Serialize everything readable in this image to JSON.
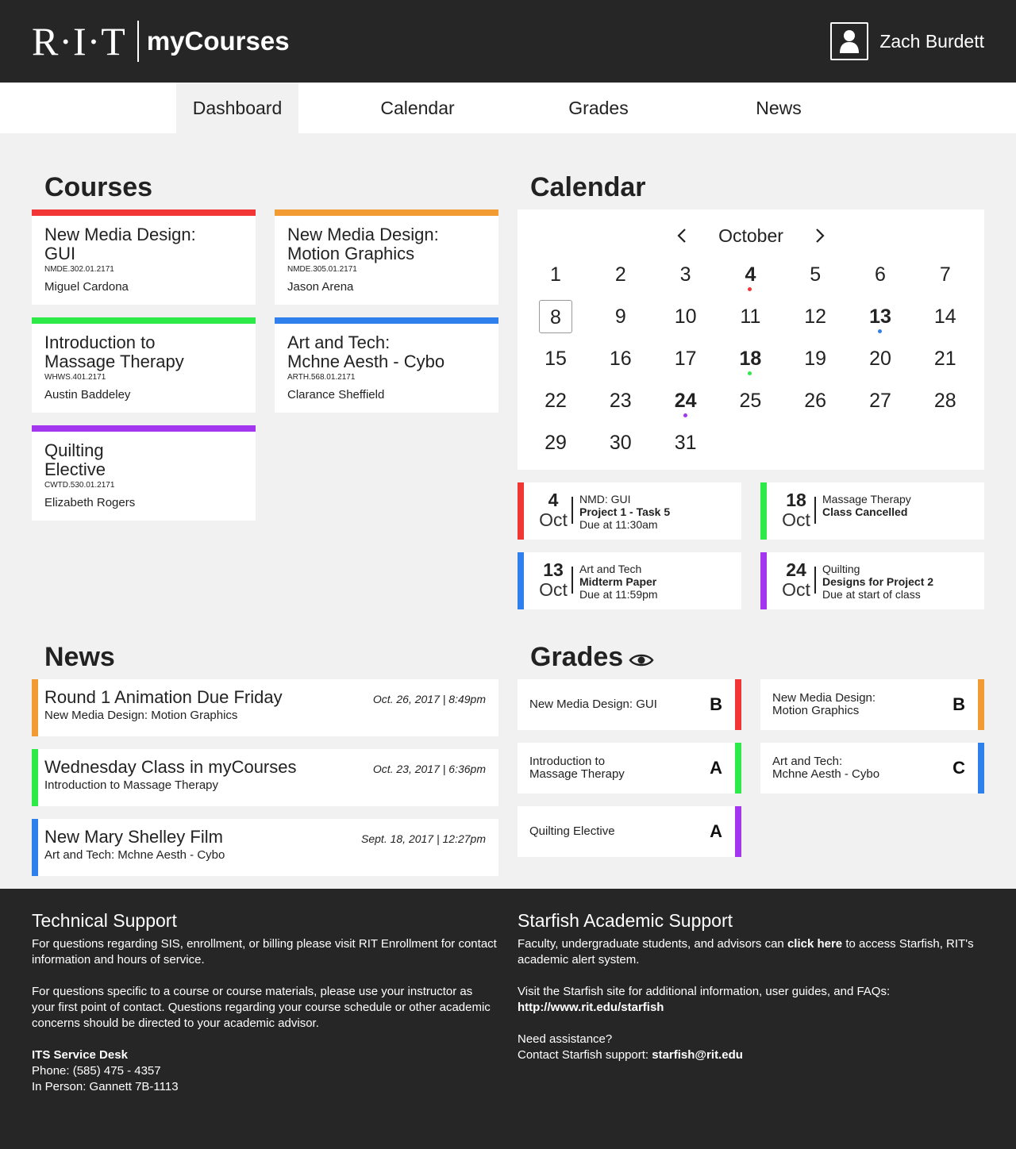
{
  "header": {
    "logo_text": "R·I·T",
    "app_name": "myCourses",
    "user_name": "Zach Burdett"
  },
  "nav": {
    "tabs": [
      {
        "label": "Dashboard",
        "active": true
      },
      {
        "label": "Calendar"
      },
      {
        "label": "Grades"
      },
      {
        "label": "News"
      }
    ]
  },
  "colors": {
    "red": "#f23535",
    "orange": "#f39b33",
    "green": "#2eea48",
    "blue": "#2f80ed",
    "purple": "#a336ef"
  },
  "courses": {
    "title": "Courses",
    "items": [
      {
        "name": "New Media Design:\nGUI",
        "code": "NMDE.302.01.2171",
        "instructor": "Miguel Cardona",
        "color": "#f23535"
      },
      {
        "name": "New Media Design:\nMotion Graphics",
        "code": "NMDE.305.01.2171",
        "instructor": "Jason Arena",
        "color": "#f39b33"
      },
      {
        "name": "Introduction to\nMassage Therapy",
        "code": "WHWS.401.2171",
        "instructor": "Austin Baddeley",
        "color": "#2eea48"
      },
      {
        "name": "Art and Tech:\nMchne Aesth - Cybo",
        "code": "ARTH.568.01.2171",
        "instructor": "Clarance Sheffield",
        "color": "#2f80ed"
      },
      {
        "name": "Quilting\nElective",
        "code": "CWTD.530.01.2171",
        "instructor": "Elizabeth Rogers",
        "color": "#a336ef"
      }
    ]
  },
  "calendar": {
    "title": "Calendar",
    "month": "October",
    "days": [
      "1",
      "2",
      "3",
      "4",
      "5",
      "6",
      "7",
      "8",
      "9",
      "10",
      "11",
      "12",
      "13",
      "14",
      "15",
      "16",
      "17",
      "18",
      "19",
      "20",
      "21",
      "22",
      "23",
      "24",
      "25",
      "26",
      "27",
      "28",
      "29",
      "30",
      "31"
    ],
    "today": "8",
    "marked": [
      {
        "day": "4",
        "color": "#f23535"
      },
      {
        "day": "13",
        "color": "#2f80ed"
      },
      {
        "day": "18",
        "color": "#2eea48"
      },
      {
        "day": "24",
        "color": "#a336ef"
      }
    ],
    "events": [
      {
        "day": "4",
        "month": "Oct",
        "course": "NMD: GUI",
        "title": "Project 1 - Task 5",
        "due": "Due at 11:30am",
        "color": "#f23535"
      },
      {
        "day": "18",
        "month": "Oct",
        "course": "Massage Therapy",
        "title": "Class Cancelled",
        "due": "",
        "color": "#2eea48"
      },
      {
        "day": "13",
        "month": "Oct",
        "course": "Art and Tech",
        "title": "Midterm Paper",
        "due": "Due at 11:59pm",
        "color": "#2f80ed"
      },
      {
        "day": "24",
        "month": "Oct",
        "course": "Quilting",
        "title": "Designs for Project 2",
        "due": "Due at start of class",
        "color": "#a336ef"
      }
    ]
  },
  "news": {
    "title": "News",
    "items": [
      {
        "title": "Round 1 Animation Due Friday",
        "course": "New Media Design: Motion Graphics",
        "date": "Oct. 26, 2017 | 8:49pm",
        "color": "#f39b33"
      },
      {
        "title": "Wednesday Class in myCourses",
        "course": "Introduction to Massage Therapy",
        "date": "Oct. 23, 2017 | 6:36pm",
        "color": "#2eea48"
      },
      {
        "title": "New Mary Shelley Film",
        "course": "Art and Tech: Mchne Aesth - Cybo",
        "date": "Sept. 18, 2017 | 12:27pm",
        "color": "#2f80ed"
      }
    ]
  },
  "grades": {
    "title": "Grades",
    "toggle_icon": "eye-icon",
    "items": [
      {
        "course": "New Media Design: GUI",
        "grade": "B",
        "color": "#f23535"
      },
      {
        "course": "New Media Design:\nMotion Graphics",
        "grade": "B",
        "color": "#f39b33"
      },
      {
        "course": "Introduction to\nMassage Therapy",
        "grade": "A",
        "color": "#2eea48"
      },
      {
        "course": "Art and Tech:\nMchne Aesth - Cybo",
        "grade": "C",
        "color": "#2f80ed"
      },
      {
        "course": "Quilting Elective",
        "grade": "A",
        "color": "#a336ef"
      }
    ]
  },
  "footer": {
    "tech": {
      "heading": "Technical Support",
      "p1": "For questions regarding SIS, enrollment, or billing please visit RIT Enrollment for contact information and hours of service.",
      "p2": "For questions specific to a course or course materials, please use your instructor as your first point of contact. Questions regarding your course schedule or other academic concerns should be directed to your academic advisor.",
      "desk_title": "ITS Service Desk",
      "phone": "Phone: (585) 475 - 4357",
      "in_person": "In Person: Gannett 7B-1113"
    },
    "starfish": {
      "heading": "Starfish Academic Support",
      "p1_pre": "Faculty, undergraduate students, and advisors can ",
      "p1_link": "click here",
      "p1_post": " to access Starfish, RIT's academic alert system.",
      "p2": "Visit the Starfish site for additional information, user guides, and FAQs:",
      "url": "http://www.rit.edu/starfish",
      "need": "Need assistance?",
      "contact_pre": "Contact Starfish support: ",
      "email": "starfish@rit.edu"
    }
  }
}
